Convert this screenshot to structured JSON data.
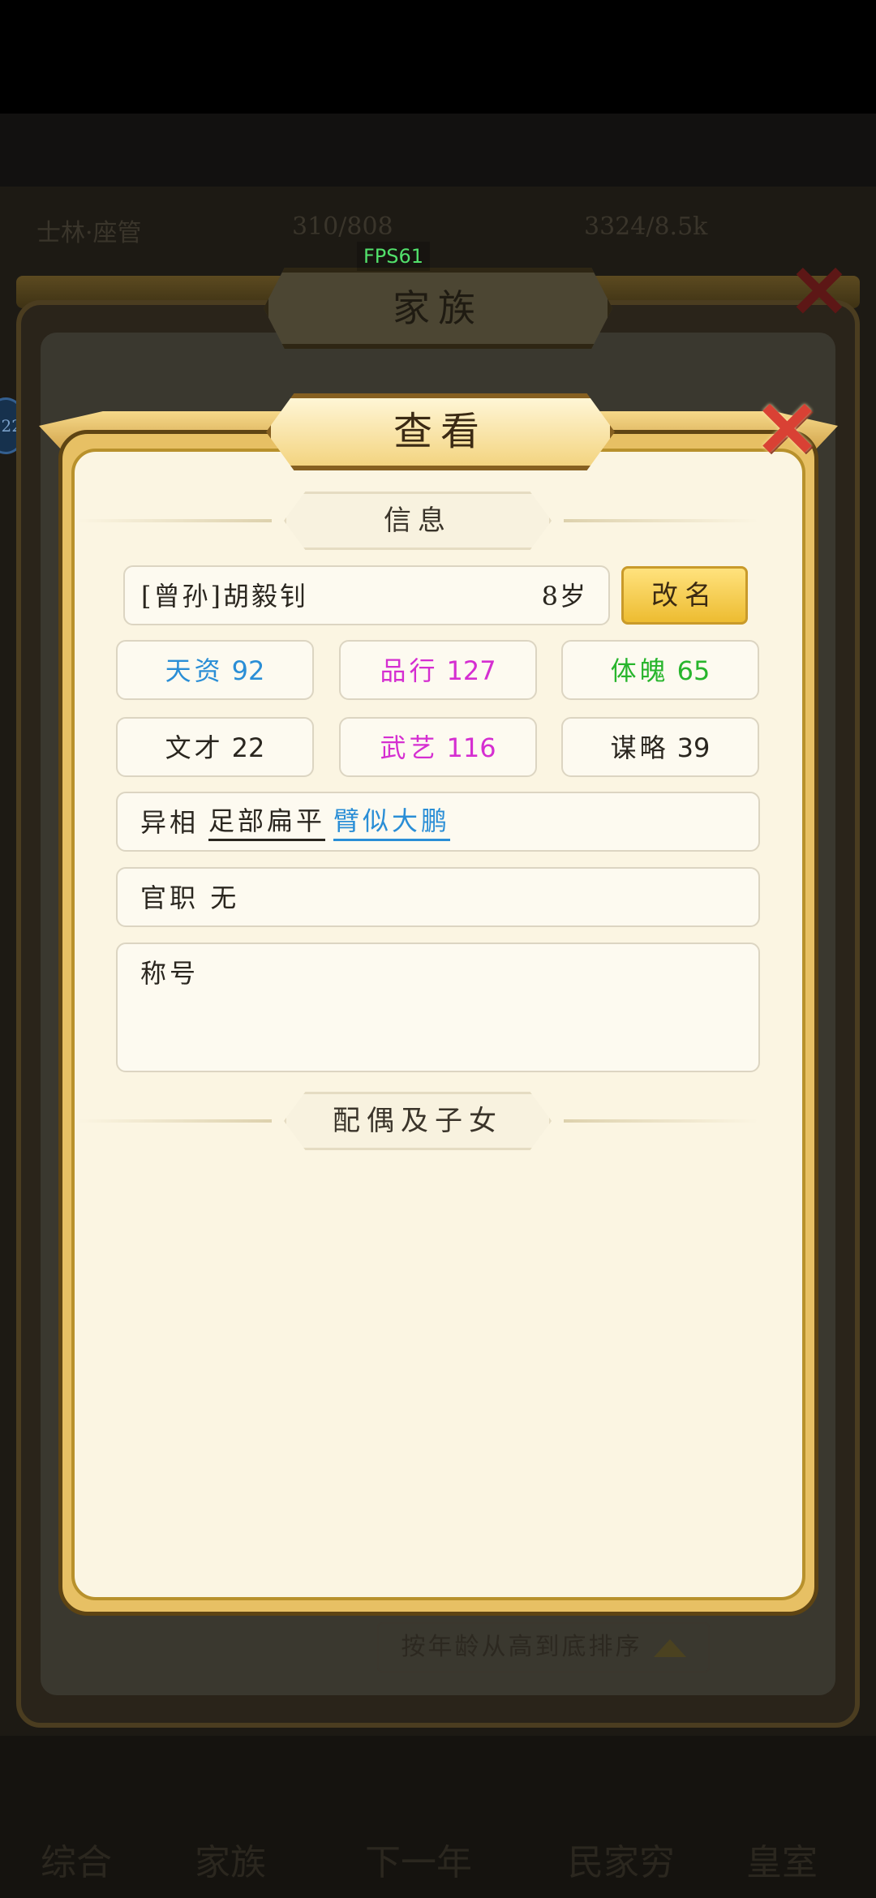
{
  "background": {
    "status_bar": {
      "left": "士林·座管",
      "middle": "310/808",
      "right": "3324/8.5k"
    },
    "bottom_nav": [
      "综合",
      "家族",
      "下一年",
      "民家穷",
      "皇室"
    ],
    "avatar_badge": "22"
  },
  "fps": "FPS61",
  "family_window": {
    "title": "家族",
    "close_icon": "red-x-close-icon",
    "sort_button": "按年龄从高到底排序"
  },
  "dialog": {
    "title": "查看",
    "close_icon": "red-x-close-icon",
    "sections": {
      "info": "信息",
      "family": "配偶及子女"
    },
    "member": {
      "name": "[曾孙]胡毅钊",
      "age": "8岁"
    },
    "rename_button": "改名",
    "stats": [
      {
        "label": "天资",
        "value": "92",
        "color": "#2a8ed6"
      },
      {
        "label": "品行",
        "value": "127",
        "color": "#d52ed1"
      },
      {
        "label": "体魄",
        "value": "65",
        "color": "#27b52c"
      },
      {
        "label": "文才",
        "value": "22",
        "color": "#2a261f"
      },
      {
        "label": "武艺",
        "value": "116",
        "color": "#d52ed1"
      },
      {
        "label": "谋略",
        "value": "39",
        "color": "#2a261f"
      }
    ],
    "traits_row": {
      "label": "异相",
      "traits": [
        "足部扁平",
        "臂似大鹏"
      ]
    },
    "office_row": {
      "label": "官职",
      "value": "无"
    },
    "titles_row": {
      "label": "称号"
    }
  }
}
